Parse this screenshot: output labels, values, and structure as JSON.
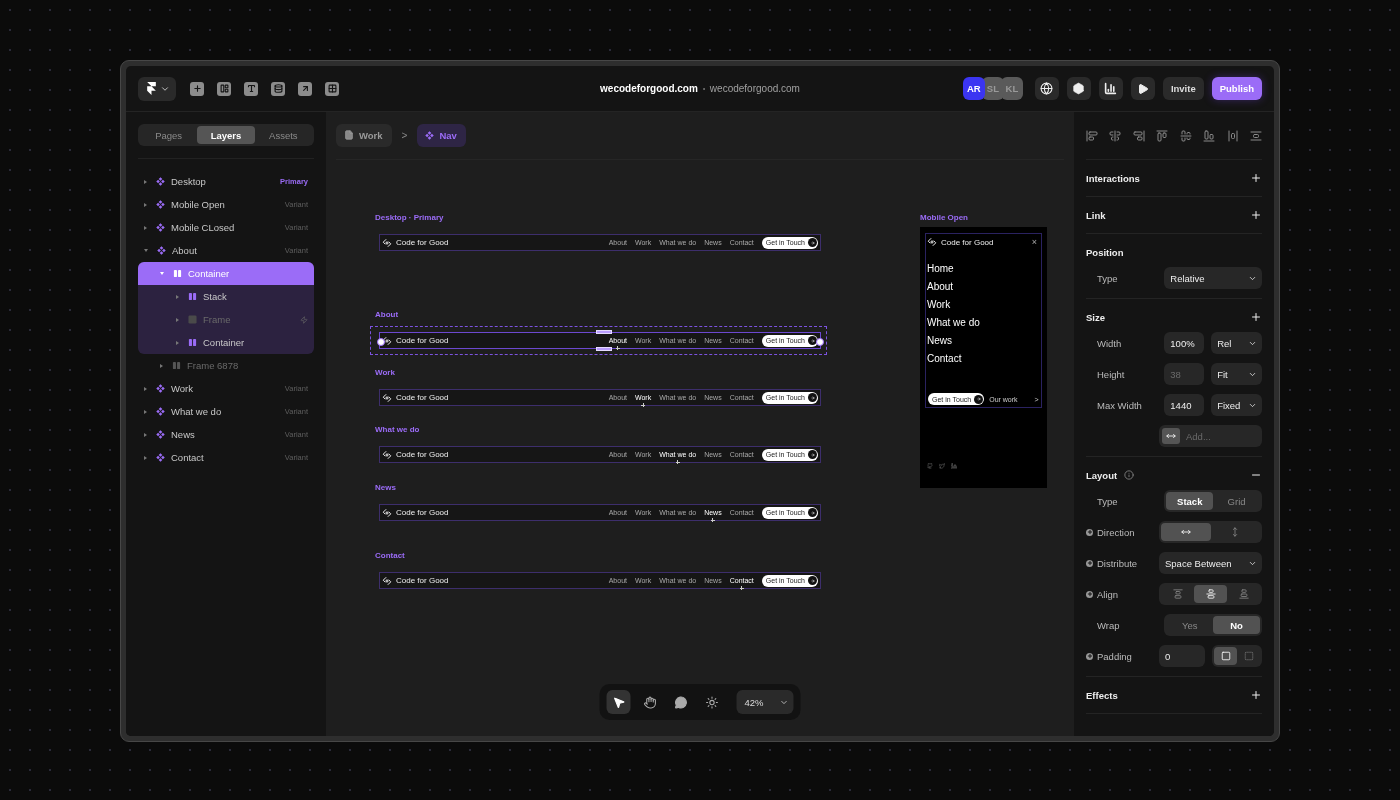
{
  "topbar": {
    "site_name": "wecodeforgood.com",
    "site_url": "wecodeforgood.com",
    "collaborators": [
      {
        "initials": "AR",
        "color": "#3b35f2"
      },
      {
        "initials": "SL",
        "color": "#5a5a5a"
      },
      {
        "initials": "KL",
        "color": "#5a5a5a"
      }
    ],
    "invite": "Invite",
    "publish": "Publish"
  },
  "panel_tabs": [
    {
      "label": "Pages",
      "selected": false
    },
    {
      "label": "Layers",
      "selected": true
    },
    {
      "label": "Assets",
      "selected": false
    }
  ],
  "layers": [
    {
      "name": "Desktop",
      "kind": "component",
      "tag": {
        "text": "Primary",
        "primary": true
      },
      "expanded": false,
      "selected": false,
      "hidden": false
    },
    {
      "name": "Mobile Open",
      "kind": "component",
      "tag": {
        "text": "Variant",
        "primary": false
      },
      "expanded": false,
      "selected": false,
      "hidden": false
    },
    {
      "name": "Mobile CLosed",
      "kind": "component",
      "tag": {
        "text": "Variant",
        "primary": false
      },
      "expanded": false,
      "selected": false,
      "hidden": false
    },
    {
      "name": "About",
      "kind": "component",
      "tag": {
        "text": "Variant",
        "primary": false
      },
      "expanded": true,
      "selected": false,
      "hidden": false,
      "children": [
        {
          "name": "Container",
          "kind": "stack",
          "expanded": true,
          "selected": true,
          "hidden": false,
          "children": [
            {
              "name": "Stack",
              "kind": "stack",
              "expanded": false,
              "selected": false,
              "hidden": false
            },
            {
              "name": "Frame",
              "kind": "frame",
              "expanded": false,
              "selected": false,
              "hidden": true,
              "effect": true
            },
            {
              "name": "Container",
              "kind": "stack",
              "expanded": false,
              "selected": false,
              "hidden": false
            }
          ]
        },
        {
          "name": "Frame 6878",
          "kind": "stack",
          "expanded": false,
          "selected": false,
          "hidden": true
        }
      ]
    },
    {
      "name": "Work",
      "kind": "component",
      "tag": {
        "text": "Variant",
        "primary": false
      },
      "expanded": false,
      "selected": false,
      "hidden": false
    },
    {
      "name": "What we do",
      "kind": "component",
      "tag": {
        "text": "Variant",
        "primary": false
      },
      "expanded": false,
      "selected": false,
      "hidden": false
    },
    {
      "name": "News",
      "kind": "component",
      "tag": {
        "text": "Variant",
        "primary": false
      },
      "expanded": false,
      "selected": false,
      "hidden": false
    },
    {
      "name": "Contact",
      "kind": "component",
      "tag": {
        "text": "Variant",
        "primary": false
      },
      "expanded": false,
      "selected": false,
      "hidden": false
    }
  ],
  "breadcrumbs": [
    {
      "label": "Work",
      "kind": "page",
      "selected": false
    },
    {
      "label": "Nav",
      "kind": "component",
      "selected": true
    }
  ],
  "breadcrumb_separator": ">",
  "desktop_variants": [
    {
      "label": "Desktop · Primary",
      "selected": false,
      "brand": "Code for Good",
      "links": [
        {
          "label": "About",
          "selected": false
        },
        {
          "label": "Work",
          "selected": false
        },
        {
          "label": "What we do",
          "selected": false
        },
        {
          "label": "News",
          "selected": false
        },
        {
          "label": "Contact",
          "selected": false
        }
      ],
      "cta": "Get in Touch"
    },
    {
      "label": "About",
      "selected": true,
      "brand": "Code for Good",
      "links": [
        {
          "label": "About",
          "selected": true
        },
        {
          "label": "Work",
          "selected": false
        },
        {
          "label": "What we do",
          "selected": false
        },
        {
          "label": "News",
          "selected": false
        },
        {
          "label": "Contact",
          "selected": false
        }
      ],
      "cta": "Get in Touch"
    },
    {
      "label": "Work",
      "selected": false,
      "brand": "Code for Good",
      "links": [
        {
          "label": "About",
          "selected": false
        },
        {
          "label": "Work",
          "selected": true
        },
        {
          "label": "What we do",
          "selected": false
        },
        {
          "label": "News",
          "selected": false
        },
        {
          "label": "Contact",
          "selected": false
        }
      ],
      "cta": "Get in Touch"
    },
    {
      "label": "What we do",
      "selected": false,
      "brand": "Code for Good",
      "links": [
        {
          "label": "About",
          "selected": false
        },
        {
          "label": "Work",
          "selected": false
        },
        {
          "label": "What we do",
          "selected": true
        },
        {
          "label": "News",
          "selected": false
        },
        {
          "label": "Contact",
          "selected": false
        }
      ],
      "cta": "Get in Touch"
    },
    {
      "label": "News",
      "selected": false,
      "brand": "Code for Good",
      "links": [
        {
          "label": "About",
          "selected": false
        },
        {
          "label": "Work",
          "selected": false
        },
        {
          "label": "What we do",
          "selected": false
        },
        {
          "label": "News",
          "selected": true
        },
        {
          "label": "Contact",
          "selected": false
        }
      ],
      "cta": "Get in Touch"
    },
    {
      "label": "Contact",
      "selected": false,
      "brand": "Code for Good",
      "links": [
        {
          "label": "About",
          "selected": false
        },
        {
          "label": "Work",
          "selected": false
        },
        {
          "label": "What we do",
          "selected": false
        },
        {
          "label": "News",
          "selected": false
        },
        {
          "label": "Contact",
          "selected": true
        }
      ],
      "cta": "Get in Touch"
    }
  ],
  "mobile_variant": {
    "label": "Mobile Open",
    "brand": "Code for Good",
    "close": "×",
    "menu": [
      "Home",
      "About",
      "Work",
      "What we do",
      "News",
      "Contact"
    ],
    "cta": "Get in Touch",
    "secondary": "Our work",
    "secondary_arrow": ">"
  },
  "canvas_tools": [
    {
      "selected": true
    },
    {
      "selected": false
    },
    {
      "selected": false
    },
    {
      "selected": false
    }
  ],
  "zoom": "42%",
  "properties": [
    {
      "title": "Interactions",
      "addable": true
    },
    {
      "title": "Link",
      "addable": true
    },
    {
      "title": "Position",
      "rows": [
        {
          "kind": "select",
          "label": "Type",
          "value": "Relative"
        }
      ]
    },
    {
      "title": "Size",
      "addable": true,
      "rows": [
        {
          "kind": "field-select",
          "label": "Width",
          "value": "100%",
          "unit": "Rel"
        },
        {
          "kind": "field-select",
          "label": "Height",
          "placeholder": "38",
          "unit": "Fit"
        },
        {
          "kind": "field-select",
          "label": "Max Width",
          "value": "1440",
          "unit": "Fixed"
        },
        {
          "kind": "add-field",
          "placeholder": "Add..."
        }
      ]
    },
    {
      "title": "Layout",
      "expanded": true,
      "info": true,
      "rows": [
        {
          "kind": "segmented",
          "label": "Type",
          "options": [
            {
              "label": "Stack",
              "selected": true
            },
            {
              "label": "Grid",
              "selected": false
            }
          ]
        },
        {
          "kind": "direction",
          "label": "Direction",
          "options": [
            {
              "selected": true
            },
            {
              "selected": false
            }
          ],
          "addable": true
        },
        {
          "kind": "select",
          "label": "Distribute",
          "value": "Space Between",
          "addable": true
        },
        {
          "kind": "align",
          "label": "Align",
          "options": [
            {
              "selected": false
            },
            {
              "selected": true
            },
            {
              "selected": false
            }
          ],
          "addable": true
        },
        {
          "kind": "segmented",
          "label": "Wrap",
          "options": [
            {
              "label": "Yes",
              "selected": false
            },
            {
              "label": "No",
              "selected": true
            }
          ]
        },
        {
          "kind": "padding",
          "label": "Padding",
          "value": "0",
          "options": [
            {
              "selected": true
            },
            {
              "selected": false
            }
          ],
          "addable": true
        }
      ]
    },
    {
      "title": "Effects",
      "addable": true
    }
  ]
}
